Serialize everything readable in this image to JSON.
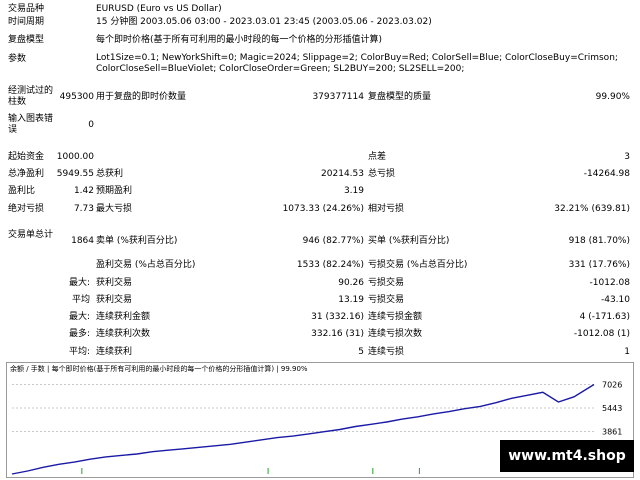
{
  "rows": {
    "symbol": {
      "label": "交易品种",
      "value": "EURUSD (Euro vs US Dollar)"
    },
    "period": {
      "label": "时间周期",
      "value": "15 分钟图 2003.05.06 03:00 - 2023.03.01 23:45 (2003.05.06 - 2023.03.02)"
    },
    "model": {
      "label": "复盘模型",
      "value": "每个即时价格(基于所有可利用的最小时段的每一个价格的分形插值计算)"
    },
    "params": {
      "label": "参数",
      "value": "Lot1Size=0.1; NewYorkShift=0; Magic=2024; Slippage=2; ColorBuy=Red; ColorSell=Blue; ColorCloseBuy=Crimson; ColorCloseSell=BlueViolet; ColorCloseOrder=Green; SL2BUY=200; SL2SELL=200;"
    },
    "bars": {
      "label": "经测试过的柱数",
      "value": "495300",
      "c2l": "用于复盘的即时价数量",
      "c2v": "379377114",
      "c3l": "复盘模型的质量",
      "c3v": "99.90%"
    },
    "errors": {
      "label": "输入图表错误",
      "value": "0"
    },
    "deposit": {
      "label": "起始资金",
      "value": "1000.00",
      "c3l": "点差",
      "c3v": "3"
    },
    "netprofit": {
      "label": "总净盈利",
      "value": "5949.55",
      "c2l": "总获利",
      "c2v": "20214.53",
      "c3l": "总亏损",
      "c3v": "-14264.98"
    },
    "pf": {
      "label": "盈利比",
      "value": "1.42",
      "c2l": "预期盈利",
      "c2v": "3.19"
    },
    "dd": {
      "label": "绝对亏损",
      "value": "7.73",
      "c2l": "最大亏损",
      "c2v": "1073.33 (24.26%)",
      "c3l": "相对亏损",
      "c3v": "32.21% (639.81)"
    },
    "trades": {
      "label": "交易单总计",
      "value": "1864",
      "c2l": "卖单 (%获利百分比)",
      "c2v": "946 (82.77%)",
      "c3l": "买单 (%获利百分比)",
      "c3v": "918 (81.70%)"
    },
    "profittrades": {
      "c2l": "盈利交易 (%占总百分比)",
      "c2v": "1533 (82.24%)",
      "c3l": "亏损交易 (%占总百分比)",
      "c3v": "331 (17.76%)"
    },
    "largest": {
      "label": "最大:",
      "c2l": "获利交易",
      "c2v": "90.26",
      "c3l": "亏损交易",
      "c3v": "-1012.08"
    },
    "average": {
      "label": "平均",
      "c2l": "获利交易",
      "c2v": "13.19",
      "c3l": "亏损交易",
      "c3v": "-43.10"
    },
    "maxcons": {
      "label": "最大:",
      "c2l": "连续获利金额",
      "c2v": "31 (332.16)",
      "c3l": "连续亏损金额",
      "c3v": "4 (-171.63)"
    },
    "maxconsamt": {
      "label": "最多:",
      "c2l": "连续获利次数",
      "c2v": "332.16 (31)",
      "c3l": "连续亏损次数",
      "c3v": "-1012.08 (1)"
    },
    "avgcons": {
      "label": "平均:",
      "c2l": "连续获利",
      "c2v": "5",
      "c3l": "连续亏损",
      "c3v": "1"
    }
  },
  "chart_data": {
    "type": "line",
    "title": "余额 / 手数 | 每个即时价格(基于所有可利用的最小时段的每一个价格的分形插值计算) | 99.90%",
    "legend": [
      "余额",
      "手数"
    ],
    "colors": {
      "balance": "#1a1aa6",
      "lots": "#2aa02a",
      "grid": "#c8c8c8"
    },
    "yticks": [
      "7026",
      "5443",
      "3861"
    ],
    "ylim": [
      1000,
      7600
    ],
    "x": [
      0,
      50,
      100,
      150,
      200,
      250,
      300,
      350,
      400,
      450,
      500,
      550,
      600,
      650,
      700,
      750,
      800,
      850,
      900,
      950,
      1000,
      1050,
      1100,
      1150,
      1200,
      1250,
      1300,
      1350,
      1400,
      1450,
      1500,
      1550,
      1600,
      1650,
      1700,
      1750,
      1800,
      1864
    ],
    "series": [
      {
        "name": "余额",
        "values": [
          1000,
          1200,
          1450,
          1650,
          1800,
          2000,
          2150,
          2250,
          2350,
          2500,
          2600,
          2700,
          2800,
          2900,
          3000,
          3150,
          3300,
          3450,
          3550,
          3700,
          3850,
          4000,
          4200,
          4350,
          4500,
          4700,
          4850,
          5050,
          5200,
          5400,
          5550,
          5800,
          6100,
          6300,
          6500,
          5850,
          6200,
          7026
        ]
      }
    ]
  },
  "watermark": "www.mt4.shop"
}
